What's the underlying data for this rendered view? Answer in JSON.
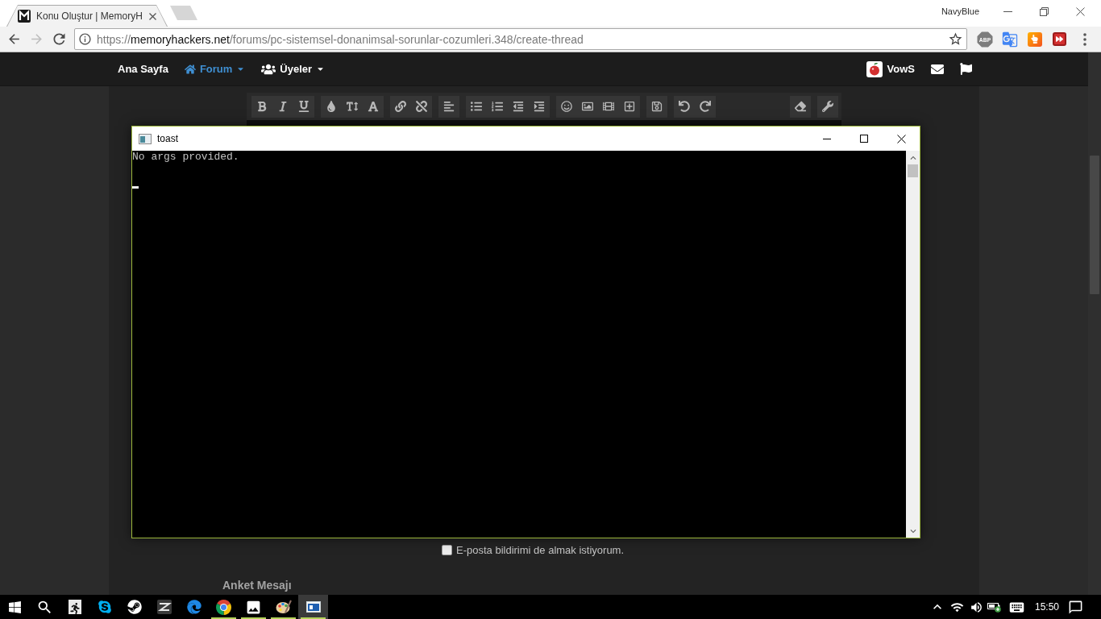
{
  "browser": {
    "tabs": [
      {
        "title": "Konu Oluştur | MemoryH",
        "selected": true
      }
    ],
    "profile": "NavyBlue",
    "back_disabled": false,
    "forward_disabled": true,
    "address": {
      "scheme": "https://",
      "host": "memoryhackers.net",
      "path": "/forums/pc-sistemsel-donanimsal-sorunlar-cozumleri.348/create-thread",
      "bookmarked": false
    },
    "extensions": [
      {
        "kind": "octagon",
        "label": "ABP"
      },
      {
        "kind": "translate"
      },
      {
        "kind": "hand"
      },
      {
        "kind": "fast-forward"
      }
    ]
  },
  "site": {
    "nav": [
      {
        "label": "Ana Sayfa",
        "kind": "link",
        "selected": false
      },
      {
        "label": "Forum",
        "kind": "home-menu",
        "selected": true
      },
      {
        "label": "Üyeler",
        "kind": "people-menu",
        "selected": false
      }
    ],
    "user": {
      "name": "VowS"
    },
    "editor_toolbar": {
      "left": [
        [
          {
            "kind": "bold"
          },
          {
            "kind": "italic"
          },
          {
            "kind": "underline"
          }
        ],
        [
          {
            "kind": "color"
          },
          {
            "kind": "size"
          },
          {
            "kind": "font"
          }
        ],
        [
          {
            "kind": "link"
          },
          {
            "kind": "unlink"
          }
        ],
        [
          {
            "kind": "align-left"
          }
        ],
        [
          {
            "kind": "bullets"
          },
          {
            "kind": "numbers"
          },
          {
            "kind": "outdent"
          },
          {
            "kind": "indent"
          }
        ],
        [
          {
            "kind": "smiley"
          },
          {
            "kind": "image"
          },
          {
            "kind": "media"
          },
          {
            "kind": "insert"
          }
        ],
        [
          {
            "kind": "save"
          }
        ],
        [
          {
            "kind": "undo"
          },
          {
            "kind": "redo"
          }
        ]
      ],
      "right": [
        [
          {
            "kind": "eraser"
          }
        ],
        [
          {
            "kind": "wrench"
          }
        ]
      ]
    },
    "email_notify": {
      "label": "E-posta bildirimi de almak istiyorum.",
      "checked": false
    },
    "poll_heading": "Anket Mesajı"
  },
  "console": {
    "title": "toast",
    "lines": [
      "No args provided."
    ],
    "cursor": true
  },
  "taskbar": {
    "apps": [
      {
        "kind": "runner",
        "running": false,
        "selected": false
      },
      {
        "kind": "skype",
        "running": false,
        "selected": false
      },
      {
        "kind": "steam",
        "running": false,
        "selected": false
      },
      {
        "kind": "stripes",
        "running": false,
        "selected": false
      },
      {
        "kind": "edge",
        "running": false,
        "selected": false
      },
      {
        "kind": "chrome",
        "running": true,
        "selected": false
      },
      {
        "kind": "photos",
        "running": true,
        "selected": false
      },
      {
        "kind": "paint",
        "running": true,
        "selected": false
      },
      {
        "kind": "console",
        "running": true,
        "selected": true
      }
    ],
    "time": "15:50"
  }
}
